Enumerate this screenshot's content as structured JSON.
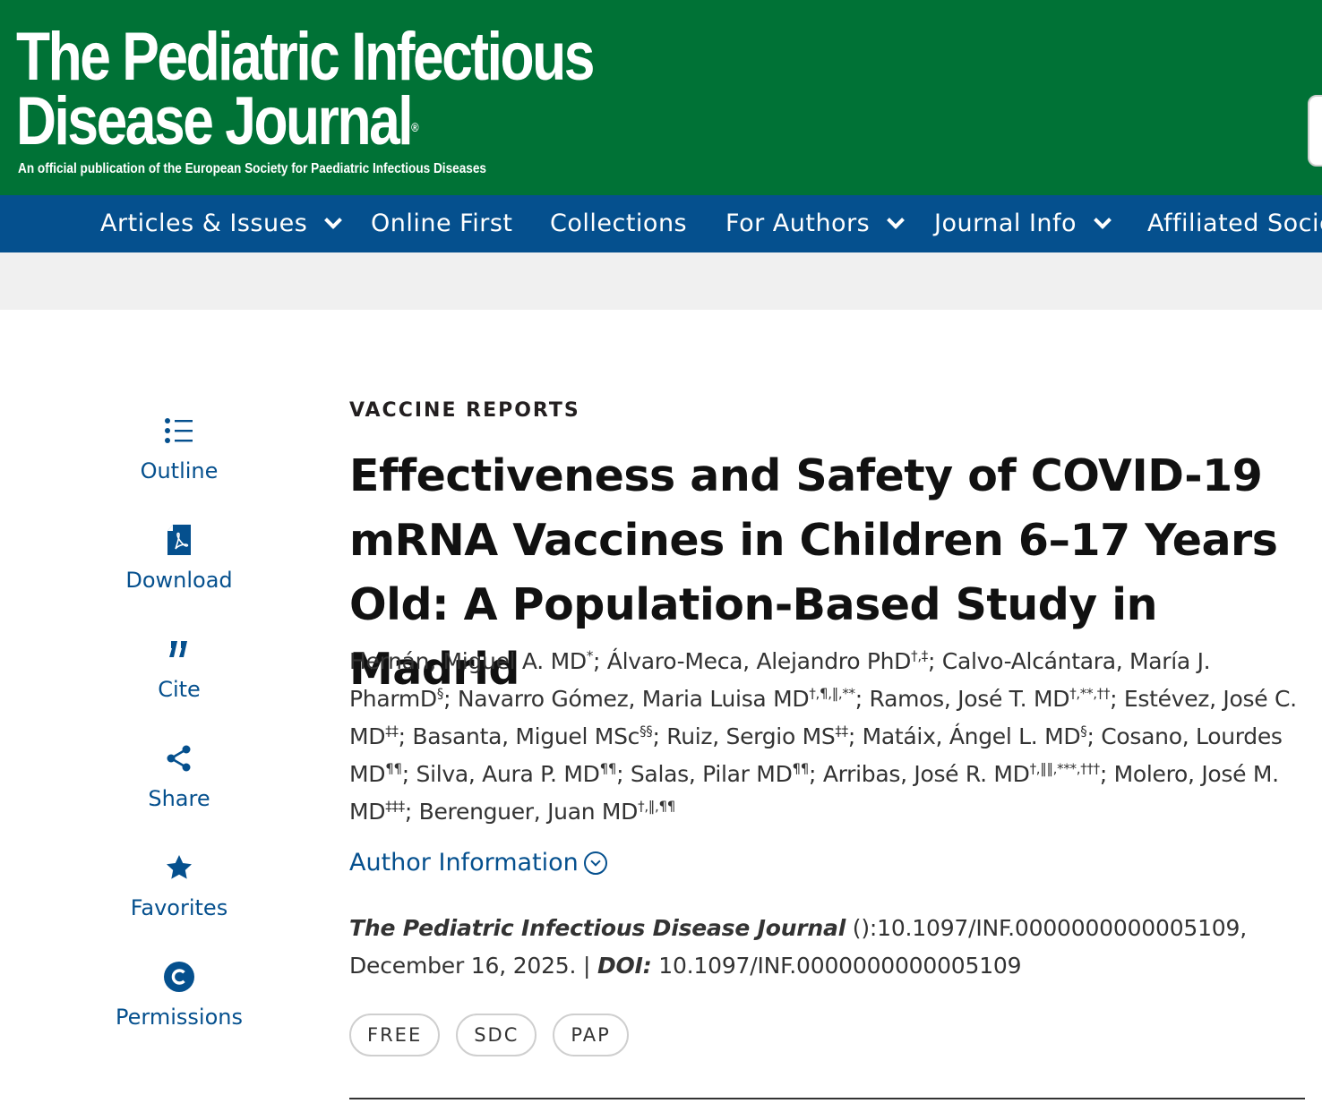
{
  "header": {
    "logo_line1": "The Pediatric Infectious",
    "logo_line2": "Disease Journal",
    "logo_reg": "®",
    "tagline": "An official publication of the European Society for Paediatric Infectious Diseases"
  },
  "nav": {
    "items": [
      {
        "label": "Articles & Issues",
        "has_dropdown": true
      },
      {
        "label": "Online First",
        "has_dropdown": false
      },
      {
        "label": "Collections",
        "has_dropdown": false
      },
      {
        "label": "For Authors",
        "has_dropdown": true
      },
      {
        "label": "Journal Info",
        "has_dropdown": true
      },
      {
        "label": "Affiliated Societies",
        "has_dropdown": false
      }
    ]
  },
  "sidebar": {
    "tools": [
      {
        "label": "Outline",
        "icon": "list-icon"
      },
      {
        "label": "Download",
        "icon": "pdf-icon"
      },
      {
        "label": "Cite",
        "icon": "quote-icon"
      },
      {
        "label": "Share",
        "icon": "share-icon"
      },
      {
        "label": "Favorites",
        "icon": "star-icon"
      },
      {
        "label": "Permissions",
        "icon": "copyright-icon"
      }
    ]
  },
  "article": {
    "section": "VACCINE REPORTS",
    "title": "Effectiveness and Safety of COVID-19 mRNA Vaccines in Children 6–17 Years Old: A Population-Based Study in Madrid",
    "authors": [
      {
        "name": "Hernán, Miguel A. MD",
        "sup": "*"
      },
      {
        "name": "Álvaro-Meca, Alejandro PhD",
        "sup": "†,‡"
      },
      {
        "name": "Calvo-Alcántara, María J. PharmD",
        "sup": "§"
      },
      {
        "name": "Navarro Gómez, Maria Luisa MD",
        "sup": "†,¶,‖,**"
      },
      {
        "name": "Ramos, José T. MD",
        "sup": "†,**,††"
      },
      {
        "name": "Estévez, José C. MD",
        "sup": "‡‡"
      },
      {
        "name": "Basanta, Miguel MSc",
        "sup": "§§"
      },
      {
        "name": "Ruiz, Sergio MS",
        "sup": "‡‡"
      },
      {
        "name": "Matáix, Ángel L. MD",
        "sup": "§"
      },
      {
        "name": "Cosano, Lourdes MD",
        "sup": "¶¶"
      },
      {
        "name": "Silva, Aura P. MD",
        "sup": "¶¶"
      },
      {
        "name": "Salas, Pilar MD",
        "sup": "¶¶"
      },
      {
        "name": "Arribas, José R. MD",
        "sup": "†,‖‖,***,†††"
      },
      {
        "name": "Molero, José M. MD",
        "sup": "‡‡‡"
      },
      {
        "name": "Berenguer, Juan MD",
        "sup": "†,‖,¶¶"
      }
    ],
    "author_info_label": "Author Information",
    "citation": {
      "journal": "The Pediatric Infectious Disease Journal",
      "ref": " ():10.1097/INF.0000000000005109, December 16, 2025. | ",
      "doi_label": "DOI:",
      "doi": " 10.1097/INF.0000000000005109"
    },
    "badges": [
      "FREE",
      "SDC",
      "PAP"
    ]
  },
  "colors": {
    "header_green": "#007236",
    "nav_blue": "#05508e",
    "link_blue": "#05508e",
    "band_grey": "#f0f0f0"
  }
}
